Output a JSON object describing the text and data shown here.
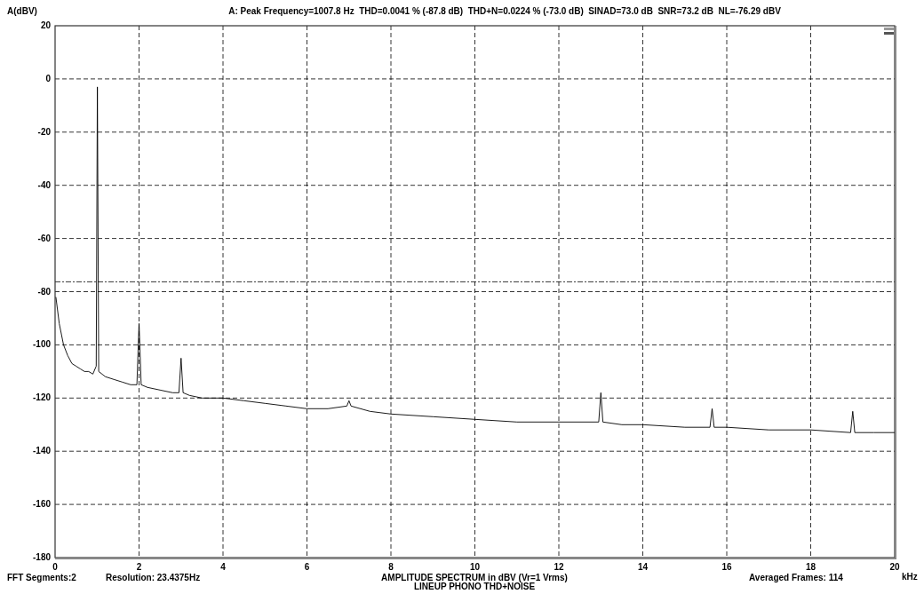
{
  "chart": {
    "chart_data": {
      "type": "line",
      "title": "A: Peak Frequency=1007.8 Hz  THD=0.0041 % (-87.8 dB)  THD+N=0.0224 % (-73.0 dB)  SINAD=73.0 dB  SNR=73.2 dB  NL=-76.29 dBV",
      "xlabel": "AMPLITUDE SPECTRUM in dBV (Vr=1 Vrms)",
      "ylabel": "A(dBV)",
      "xlim": [
        0,
        20
      ],
      "ylim": [
        -180,
        20
      ],
      "xticks": [
        0,
        2,
        4,
        6,
        8,
        10,
        12,
        14,
        16,
        18,
        20
      ],
      "yticks": [
        -180,
        -160,
        -140,
        -120,
        -100,
        -80,
        -60,
        -40,
        -20,
        0,
        20
      ],
      "x": [
        0.02,
        0.1,
        0.2,
        0.3,
        0.4,
        0.5,
        0.6,
        0.7,
        0.8,
        0.9,
        0.98,
        1.008,
        1.04,
        1.2,
        1.4,
        1.6,
        1.8,
        1.95,
        2.0,
        2.05,
        2.2,
        2.5,
        2.8,
        2.95,
        3.0,
        3.05,
        3.2,
        3.5,
        4,
        4.5,
        5,
        5.5,
        6,
        6.5,
        6.95,
        7.0,
        7.05,
        7.5,
        8,
        9,
        10,
        11,
        12,
        12.95,
        13.0,
        13.05,
        13.5,
        14,
        15,
        15.6,
        15.65,
        15.7,
        16,
        17,
        18,
        18.95,
        19.0,
        19.05,
        19.5,
        20
      ],
      "series": [
        {
          "color": "#000000",
          "values": [
            -82,
            -92,
            -100,
            -104,
            -107,
            -108,
            -109,
            -110,
            -110,
            -111,
            -108,
            -3,
            -110,
            -112,
            -113,
            -114,
            -115,
            -115,
            -92,
            -115,
            -116,
            -117,
            -118,
            -118,
            -105,
            -118,
            -119,
            -120,
            -120,
            -121,
            -122,
            -123,
            -124,
            -124,
            -123,
            -121,
            -123,
            -125,
            -126,
            -127,
            -128,
            -129,
            -129,
            -129,
            -118,
            -129,
            -130,
            -130,
            -131,
            -131,
            -124,
            -131,
            -131,
            -132,
            -132,
            -133,
            -125,
            -133,
            -133,
            -133
          ]
        }
      ],
      "grid": true,
      "ref_lines": [
        {
          "axis": "y",
          "value": -76.29
        }
      ]
    },
    "x_unit": "kHz",
    "subtitle": "LINEUP PHONO THD+NOISE",
    "fft_segments": "FFT Segments:2",
    "resolution": "Resolution: 23.4375Hz",
    "averaged_frames": "Averaged Frames: 114"
  }
}
